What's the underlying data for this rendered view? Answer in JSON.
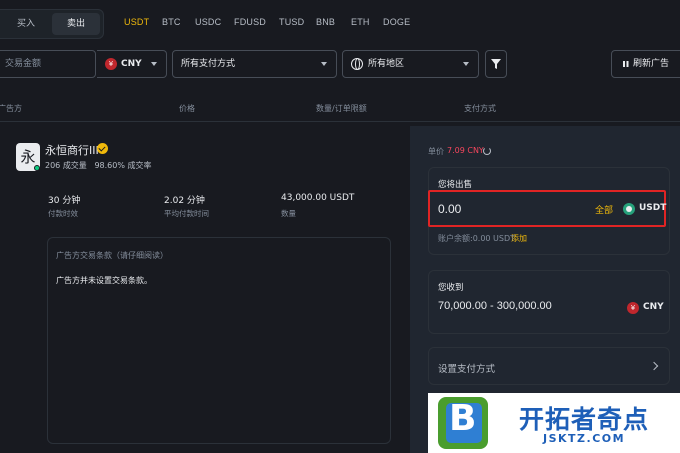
{
  "tabs": {
    "buy": "买入",
    "sell": "卖出"
  },
  "coins": [
    "USDT",
    "BTC",
    "USDC",
    "FDUSD",
    "TUSD",
    "BNB",
    "ETH",
    "DOGE"
  ],
  "filters": {
    "amount_placeholder": "交易金额",
    "currency": "CNY",
    "payment": "所有支付方式",
    "region": "所有地区",
    "refresh": "刷新广告"
  },
  "headers": [
    "广告方",
    "价格",
    "数量/订单限额",
    "支付方式"
  ],
  "advertiser": {
    "avatar_char": "永",
    "name": "永恒商行III",
    "stats": "206 成交量   98.60% 成交率",
    "metrics": [
      {
        "value": "30 分钟",
        "label": "付款时效"
      },
      {
        "value": "2.02 分钟",
        "label": "平均付款时间"
      },
      {
        "value": "43,000.00 USDT",
        "label": "数量"
      }
    ],
    "terms_title": "广告方交易条款（请仔细阅读）",
    "terms_body": "广告方并未设置交易条款。"
  },
  "order": {
    "price_label": "单价",
    "price_value": "7.09 CNY",
    "sell_label": "您将出售",
    "amount": "0.00",
    "all_label": "全部",
    "sell_coin": "USDT",
    "balance": "账户余额:0.00 USDT",
    "add_label": "添加",
    "receive_label": "您收到",
    "receive_range": "70,000.00 - 300,000.00",
    "receive_currency": "CNY",
    "currency_symbol": "¥",
    "payment_label": "设置支付方式"
  },
  "watermark": {
    "logo_letter": "B",
    "cn": "开拓者奇点",
    "en": "JSKTZ.COM"
  },
  "colors": {
    "accent": "#f0b90b",
    "price": "#f6465d",
    "highlight": "#e02424"
  }
}
